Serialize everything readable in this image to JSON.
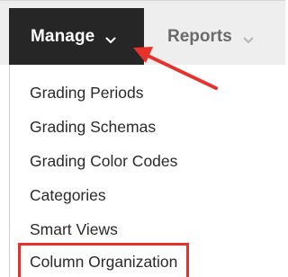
{
  "tabs": {
    "manage_label": "Manage",
    "reports_label": "Reports"
  },
  "menu": {
    "items": [
      {
        "label": "Grading Periods"
      },
      {
        "label": "Grading Schemas"
      },
      {
        "label": "Grading Color Codes"
      },
      {
        "label": "Categories"
      },
      {
        "label": "Smart Views"
      },
      {
        "label": "Column Organization"
      }
    ],
    "highlighted_item": "Column Organization"
  },
  "icons": {
    "manage_chevron": "chevron-down-icon",
    "reports_chevron": "chevron-down-icon",
    "pointer": "arrow-pointer-icon"
  },
  "colors": {
    "active_tab_bg": "#262626",
    "tabbar_bg": "#eeeeee",
    "highlight": "#e8312a",
    "arrow": "#e8312a"
  }
}
